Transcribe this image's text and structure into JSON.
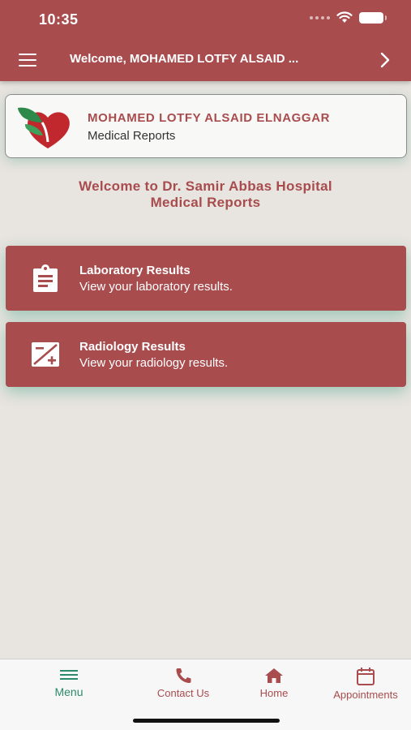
{
  "status_bar": {
    "time": "10:35"
  },
  "nav": {
    "title": "Welcome, MOHAMED LOTFY ALSAID ..."
  },
  "profile": {
    "name": "MOHAMED LOTFY ALSAID ELNAGGAR",
    "subtitle": "Medical Reports"
  },
  "welcome": {
    "line1": "Welcome to Dr. Samir Abbas Hospital",
    "line2": "Medical Reports"
  },
  "cards": [
    {
      "title": "Laboratory Results",
      "description": "View your laboratory results.",
      "icon": "clipboard-icon"
    },
    {
      "title": "Radiology Results",
      "description": "View your radiology results.",
      "icon": "xray-image-icon"
    }
  ],
  "tabs": [
    {
      "label": "Menu",
      "icon": "menu-icon",
      "active": true
    },
    {
      "label": "Contact Us",
      "icon": "phone-icon"
    },
    {
      "label": "Home",
      "icon": "home-icon"
    },
    {
      "label": "Appointments",
      "icon": "calendar-icon"
    }
  ],
  "colors": {
    "brand": "#a84c4e",
    "active_tab": "#2e8a6a",
    "background": "#e8e4df"
  }
}
